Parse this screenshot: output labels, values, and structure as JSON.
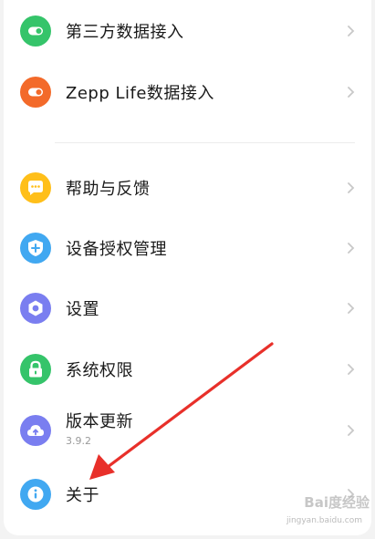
{
  "menu": {
    "group1": [
      {
        "label": "第三方数据接入",
        "icon": "toggle-icon",
        "color": "#35c46a"
      },
      {
        "label": "Zepp Life数据接入",
        "icon": "toggle-icon",
        "color": "#f36a2a"
      }
    ],
    "group2": [
      {
        "label": "帮助与反馈",
        "icon": "chat-bubble-icon",
        "color": "#ffbf1a"
      },
      {
        "label": "设备授权管理",
        "icon": "shield-icon",
        "color": "#41a8f1"
      },
      {
        "label": "设置",
        "icon": "gear-hexagon-icon",
        "color": "#7a7ef0"
      },
      {
        "label": "系统权限",
        "icon": "lock-icon",
        "color": "#35c46a"
      },
      {
        "label": "版本更新",
        "sublabel": "3.9.2",
        "icon": "cloud-upload-icon",
        "color": "#7a7ef0"
      },
      {
        "label": "关于",
        "icon": "info-icon",
        "color": "#41a8f1"
      }
    ]
  },
  "watermark": {
    "text": "Bai度经验",
    "url": "jingyan.baidu.com"
  },
  "annotation": {
    "arrow_color": "#e8302a"
  }
}
